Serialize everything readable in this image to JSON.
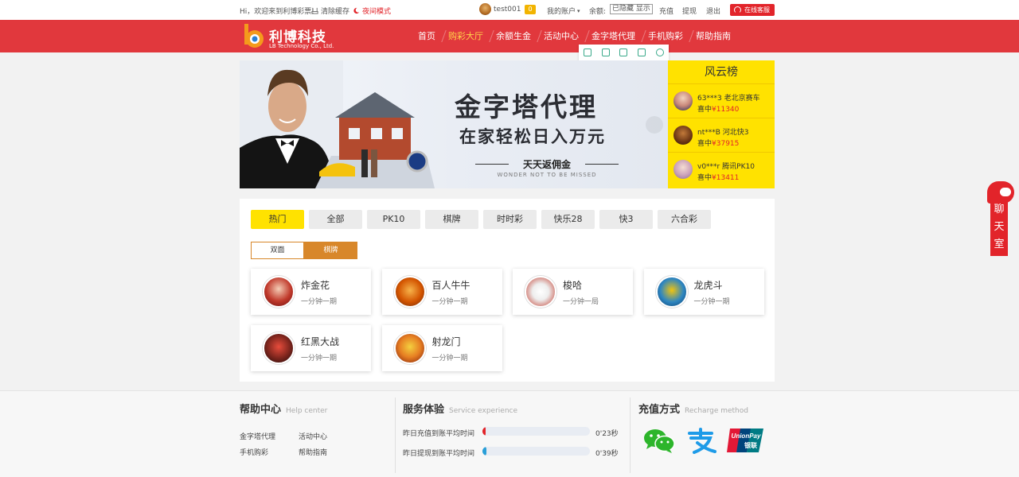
{
  "topbar": {
    "welcome": "Hi，欢迎来到利博彩票!",
    "clear_cache": "清除缓存",
    "night_mode": "夜间模式",
    "username": "test001",
    "vip": "0",
    "my_account": "我的账户",
    "balance_label": "余额:",
    "balance_hidden": "已隐藏",
    "balance_show": "显示",
    "recharge": "充值",
    "withdraw": "提现",
    "logout": "退出",
    "online_service": "在线客服"
  },
  "logo": {
    "name": "利博科技",
    "subtitle": "LB Technology Co., Ltd."
  },
  "nav": {
    "items": [
      "首页",
      "购彩大厅",
      "余额生金",
      "活动中心",
      "金字塔代理",
      "手机购彩",
      "帮助指南"
    ],
    "active_index": 1
  },
  "banner": {
    "headline": "金字塔代理",
    "subline": "在家轻松日入万元",
    "slogan": "天天返佣金",
    "tagline": "WONDER NOT TO BE MISSED"
  },
  "leaderboard": {
    "title": "风云榜",
    "items": [
      {
        "user": "63***3",
        "game": "老北京赛车",
        "prefix": "喜中",
        "amount": "¥11340"
      },
      {
        "user": "nt***B",
        "game": "河北快3",
        "prefix": "喜中",
        "amount": "¥37915"
      },
      {
        "user": "v0***r",
        "game": "腾讯PK10",
        "prefix": "喜中",
        "amount": "¥13411"
      }
    ]
  },
  "categories": {
    "tabs": [
      "热门",
      "全部",
      "PK10",
      "棋牌",
      "时时彩",
      "快乐28",
      "快3",
      "六合彩"
    ],
    "active_index": 0
  },
  "subtabs": {
    "tabs": [
      "双面",
      "棋牌"
    ],
    "active_index": 1
  },
  "games": [
    {
      "name": "炸金花",
      "freq": "一分钟一期"
    },
    {
      "name": "百人牛牛",
      "freq": "一分钟一期"
    },
    {
      "name": "梭哈",
      "freq": "一分钟一局"
    },
    {
      "name": "龙虎斗",
      "freq": "一分钟一期"
    },
    {
      "name": "红黑大战",
      "freq": "一分钟一期"
    },
    {
      "name": "射龙门",
      "freq": "一分钟一期"
    }
  ],
  "chat": {
    "label": "聊天室"
  },
  "footer": {
    "help": {
      "title": "帮助中心",
      "title_en": "Help center",
      "links": [
        "金字塔代理",
        "活动中心",
        "手机购彩",
        "帮助指南"
      ]
    },
    "service": {
      "title": "服务体验",
      "title_en": "Service experience",
      "stats": [
        {
          "label": "昨日充值到账平均时间",
          "value": "0'23秒",
          "fill": 0.02,
          "color": "#e2242a"
        },
        {
          "label": "昨日提现到账平均时间",
          "value": "0'39秒",
          "fill": 0.04,
          "color": "#2a9fd8"
        }
      ]
    },
    "payment": {
      "title": "充值方式",
      "title_en": "Recharge method",
      "methods": [
        "wechat-pay",
        "alipay",
        "unionpay"
      ],
      "unionpay_text": "UnionPay",
      "unionpay_cn": "银联"
    }
  }
}
